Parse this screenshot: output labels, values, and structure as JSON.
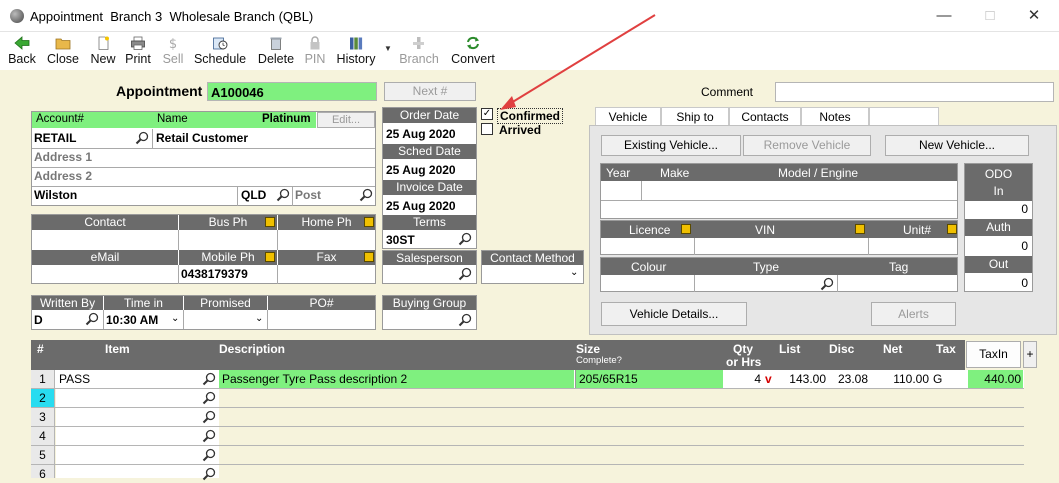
{
  "window": {
    "title": "Appointment  Branch 3  Wholesale Branch (QBL)"
  },
  "toolbar": {
    "back": "Back",
    "close": "Close",
    "new": "New",
    "print": "Print",
    "sell": "Sell",
    "schedule": "Schedule",
    "delete": "Delete",
    "pin": "PIN",
    "history": "History",
    "branch": "Branch",
    "convert": "Convert"
  },
  "header": {
    "appointment_label": "Appointment",
    "appointment_no": "A100046",
    "next_button": "Next #",
    "comment_label": "Comment",
    "comment_value": ""
  },
  "account": {
    "account_label": "Account#",
    "name_label": "Name",
    "tier": "Platinum",
    "edit_button": "Edit...",
    "account_no": "RETAIL",
    "name": "Retail Customer",
    "address1_placeholder": "Address 1",
    "address2_placeholder": "Address 2",
    "suburb": "Wilston",
    "state": "QLD",
    "post_placeholder": "Post"
  },
  "contact": {
    "contact_label": "Contact",
    "bus_ph_label": "Bus Ph",
    "home_ph_label": "Home Ph",
    "email_label": "eMail",
    "mobile_label": "Mobile Ph",
    "fax_label": "Fax",
    "contact": "",
    "bus_ph": "",
    "home_ph": "",
    "email": "",
    "mobile": "0438179379",
    "fax": ""
  },
  "written": {
    "written_by_label": "Written By",
    "time_in_label": "Time in",
    "promised_label": "Promised",
    "po_label": "PO#",
    "written_by": "D",
    "time_in": "10:30 AM",
    "promised": "",
    "po": ""
  },
  "dates": {
    "order_label": "Order Date",
    "order": "25 Aug 2020",
    "sched_label": "Sched Date",
    "sched": "25 Aug 2020",
    "invoice_label": "Invoice Date",
    "invoice": "25 Aug 2020",
    "terms_label": "Terms",
    "terms": "30ST",
    "salesperson_label": "Salesperson",
    "salesperson": "",
    "contact_method_label": "Contact Method",
    "contact_method": "",
    "buying_group_label": "Buying Group",
    "buying_group": ""
  },
  "status": {
    "confirmed_label": "Confirmed",
    "confirmed": true,
    "arrived_label": "Arrived",
    "arrived": false
  },
  "tabs": [
    "Vehicle",
    "Ship to",
    "Contacts",
    "Notes"
  ],
  "vehicle": {
    "existing_button": "Existing Vehicle...",
    "remove_button": "Remove Vehicle",
    "new_button": "New Vehicle...",
    "year_label": "Year",
    "make_label": "Make",
    "model_label": "Model / Engine",
    "odo_label": "ODO",
    "in_label": "In",
    "in_value": "0",
    "licence_label": "Licence",
    "vin_label": "VIN",
    "unit_label": "Unit#",
    "auth_label": "Auth",
    "auth_value": "0",
    "colour_label": "Colour",
    "type_label": "Type",
    "tag_label": "Tag",
    "out_label": "Out",
    "out_value": "0",
    "details_button": "Vehicle Details...",
    "alerts_button": "Alerts"
  },
  "items": {
    "headers": {
      "num": "#",
      "item": "Item",
      "description": "Description",
      "size": "Size",
      "complete": "Complete?",
      "qty": "Qty",
      "or_hrs": "or Hrs",
      "list": "List",
      "disc": "Disc",
      "net": "Net",
      "tax": "Tax"
    },
    "taxin_button": "TaxIn",
    "plus_button": "+",
    "rows": [
      {
        "num": "1",
        "item": "PASS",
        "description": "Passenger Tyre Pass description 2",
        "size": "205/65R15",
        "qty": "4",
        "flag": "v",
        "list": "143.00",
        "disc": "23.08",
        "net": "110.00",
        "tax": "G",
        "total": "440.00"
      },
      {
        "num": "2"
      },
      {
        "num": "3"
      },
      {
        "num": "4"
      },
      {
        "num": "5"
      },
      {
        "num": "6"
      }
    ]
  },
  "colors": {
    "accent_green": "#7ff07f",
    "header_gray": "#6b6b6b",
    "background": "#f6f3dc",
    "annotation_arrow": "#e04040"
  }
}
